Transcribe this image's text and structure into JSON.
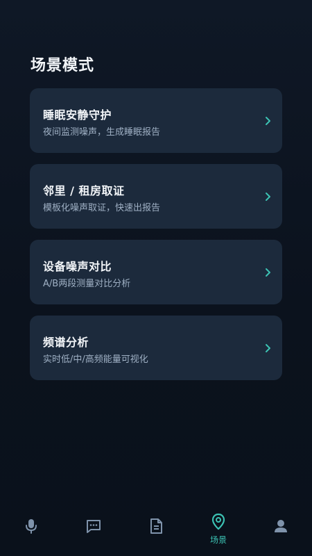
{
  "page": {
    "title": "场景模式"
  },
  "scenes": [
    {
      "title": "睡眠安静守护",
      "subtitle": "夜间监测噪声，生成睡眠报告"
    },
    {
      "title": "邻里 / 租房取证",
      "subtitle": "模板化噪声取证，快速出报告"
    },
    {
      "title": "设备噪声对比",
      "subtitle": "A/B两段测量对比分析"
    },
    {
      "title": "频谱分析",
      "subtitle": "实时低/中/高频能量可视化"
    }
  ],
  "nav": {
    "items": [
      {
        "icon": "microphone-icon",
        "active": false
      },
      {
        "icon": "chat-bubble-icon",
        "active": false
      },
      {
        "icon": "document-icon",
        "active": false
      },
      {
        "icon": "location-pin-icon",
        "label": "场景",
        "active": true
      },
      {
        "icon": "user-icon",
        "active": false
      }
    ]
  },
  "colors": {
    "background": "#0d1521",
    "card": "#1c2a3c",
    "accent": "#3cc3b4",
    "icon_inactive": "#7f93ab"
  }
}
